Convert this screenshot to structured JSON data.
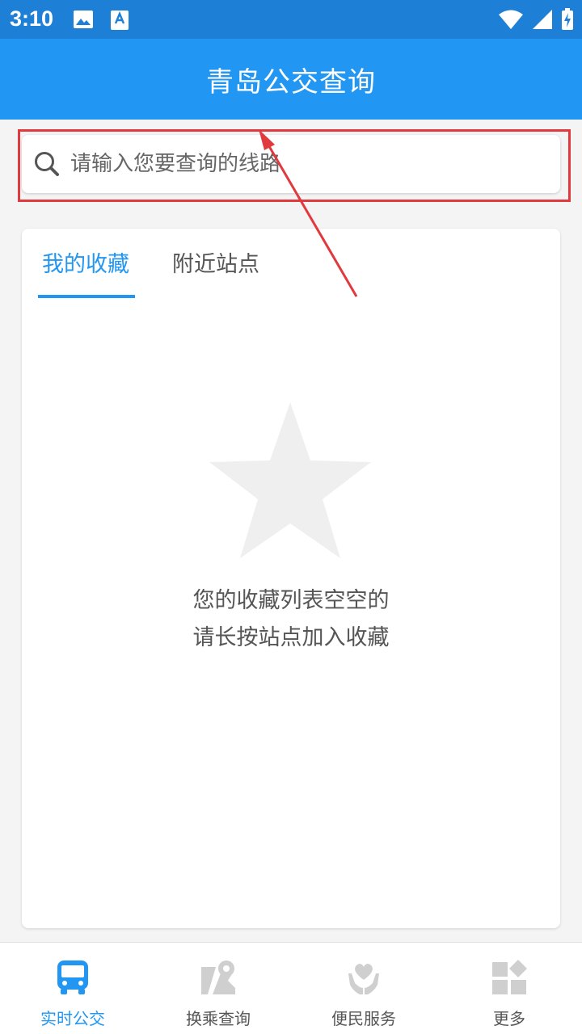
{
  "status_bar": {
    "time": "3:10"
  },
  "header": {
    "title": "青岛公交查询"
  },
  "search": {
    "placeholder": "请输入您要查询的线路"
  },
  "tabs": [
    {
      "label": "我的收藏",
      "active": true
    },
    {
      "label": "附近站点",
      "active": false
    }
  ],
  "empty_state": {
    "icon": "star-icon",
    "line1": "您的收藏列表空空的",
    "line2": "请长按站点加入收藏"
  },
  "bottom_nav": [
    {
      "label": "实时公交",
      "icon": "bus-icon",
      "active": true
    },
    {
      "label": "换乘查询",
      "icon": "map-pin-icon",
      "active": false
    },
    {
      "label": "便民服务",
      "icon": "heart-hands-icon",
      "active": false
    },
    {
      "label": "更多",
      "icon": "grid-icon",
      "active": false
    }
  ],
  "colors": {
    "primary": "#2196f3",
    "status_bar": "#1e7fd6",
    "annotation": "#e0393e",
    "inactive_icon": "#cfcfcf",
    "star": "#efefef"
  }
}
